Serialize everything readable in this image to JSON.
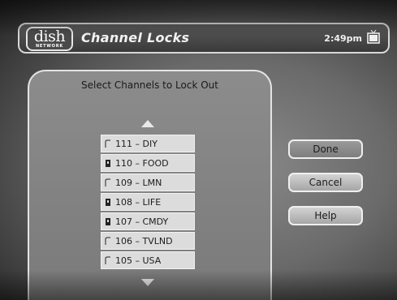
{
  "header": {
    "logo_text": "dish",
    "logo_subtext": "NETWORK",
    "title": "Channel Locks",
    "time": "2:49pm",
    "tv_icon": "tv-icon"
  },
  "panel": {
    "heading": "Select Channels to Lock Out",
    "channels": [
      {
        "label": "111 – DIY",
        "locked": false
      },
      {
        "label": "110 – FOOD",
        "locked": true
      },
      {
        "label": "109 – LMN",
        "locked": false
      },
      {
        "label": "108 – LIFE",
        "locked": true
      },
      {
        "label": "107 – CMDY",
        "locked": true
      },
      {
        "label": "106 – TVLND",
        "locked": false
      },
      {
        "label": "105 – USA",
        "locked": false
      }
    ]
  },
  "buttons": {
    "done": "Done",
    "cancel": "Cancel",
    "help": "Help"
  },
  "colors": {
    "background": "#6a6a6a",
    "row": "#dcdcdc",
    "border": "#e4e4e4"
  }
}
